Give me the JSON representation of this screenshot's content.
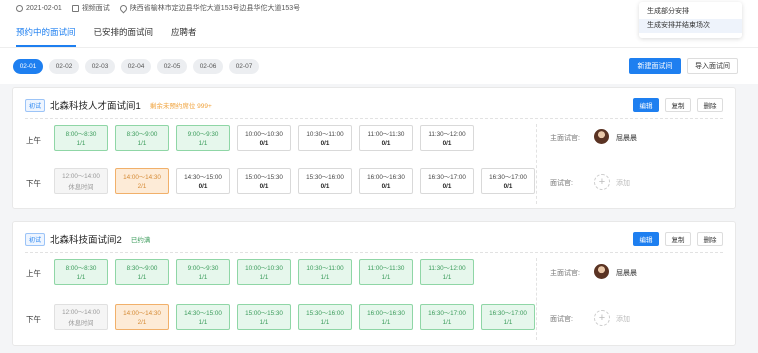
{
  "header": {
    "date": "2021-02-01",
    "mode": "视频面试",
    "address": "陕西省榆林市定边县华佗大道153号边县华佗大道153号"
  },
  "tabs": [
    "预约中的面试间",
    "已安排的面试间",
    "应聘者"
  ],
  "menu": [
    "生成部分安排",
    "生成安排并结束场次"
  ],
  "dates": [
    "02-01",
    "02-02",
    "02-03",
    "02-04",
    "02-05",
    "02-06",
    "02-07"
  ],
  "buttons": {
    "new_room": "新建面试间",
    "import_room": "导入面试间"
  },
  "colors": {
    "primary": "#1e7ff0",
    "booked_green": "#3a9b5a",
    "partial_orange": "#d58b36",
    "remaining_orange": "#f0a23b"
  },
  "labels": {
    "am": "上午",
    "pm": "下午",
    "main_interviewer": "主面试官:",
    "interviewer": "面试官:",
    "add": "添加",
    "edit": "编辑",
    "copy": "复制",
    "delete": "删除"
  },
  "cards": [
    {
      "badge": "初试",
      "title": "北森科技人才面试间1",
      "status": "剩余未预约席位 999+",
      "main_interviewer": "屈晨晨",
      "am": [
        {
          "time": "8:00～8:30",
          "count": "1/1",
          "state": "g"
        },
        {
          "time": "8:30～9:00",
          "count": "1/1",
          "state": "g"
        },
        {
          "time": "9:00～9:30",
          "count": "1/1",
          "state": "g"
        },
        {
          "time": "10:00～10:30",
          "count": "0/1",
          "state": "n"
        },
        {
          "time": "10:30～11:00",
          "count": "0/1",
          "state": "n"
        },
        {
          "time": "11:00～11:30",
          "count": "0/1",
          "state": "n"
        },
        {
          "time": "11:30～12:00",
          "count": "0/1",
          "state": "n"
        }
      ],
      "pm": [
        {
          "time": "12:00～14:00",
          "count": "休息时间",
          "state": "rest"
        },
        {
          "time": "14:00～14:30",
          "count": "2/1",
          "state": "o"
        },
        {
          "time": "14:30～15:00",
          "count": "0/1",
          "state": "n"
        },
        {
          "time": "15:00～15:30",
          "count": "0/1",
          "state": "n"
        },
        {
          "time": "15:30～16:00",
          "count": "0/1",
          "state": "n"
        },
        {
          "time": "16:00～16:30",
          "count": "0/1",
          "state": "n"
        },
        {
          "time": "16:30～17:00",
          "count": "0/1",
          "state": "n"
        },
        {
          "time": "16:30～17:00",
          "count": "0/1",
          "state": "n"
        }
      ]
    },
    {
      "badge": "初试",
      "title": "北森科技面试间2",
      "status": "已约满",
      "main_interviewer": "屈晨晨",
      "am": [
        {
          "time": "8:00～8:30",
          "count": "1/1",
          "state": "g"
        },
        {
          "time": "8:30～9:00",
          "count": "1/1",
          "state": "g"
        },
        {
          "time": "9:00～9:30",
          "count": "1/1",
          "state": "g"
        },
        {
          "time": "10:00～10:30",
          "count": "1/1",
          "state": "g"
        },
        {
          "time": "10:30～11:00",
          "count": "1/1",
          "state": "g"
        },
        {
          "time": "11:00～11:30",
          "count": "1/1",
          "state": "g"
        },
        {
          "time": "11:30～12:00",
          "count": "1/1",
          "state": "g"
        }
      ],
      "pm": [
        {
          "time": "12:00～14:00",
          "count": "休息时间",
          "state": "rest"
        },
        {
          "time": "14:00～14:30",
          "count": "2/1",
          "state": "o"
        },
        {
          "time": "14:30～15:00",
          "count": "1/1",
          "state": "g"
        },
        {
          "time": "15:00～15:30",
          "count": "1/1",
          "state": "g"
        },
        {
          "time": "15:30～16:00",
          "count": "1/1",
          "state": "g"
        },
        {
          "time": "16:00～16:30",
          "count": "1/1",
          "state": "g"
        },
        {
          "time": "16:30～17:00",
          "count": "1/1",
          "state": "g"
        },
        {
          "time": "16:30～17:00",
          "count": "1/1",
          "state": "g"
        }
      ]
    }
  ]
}
